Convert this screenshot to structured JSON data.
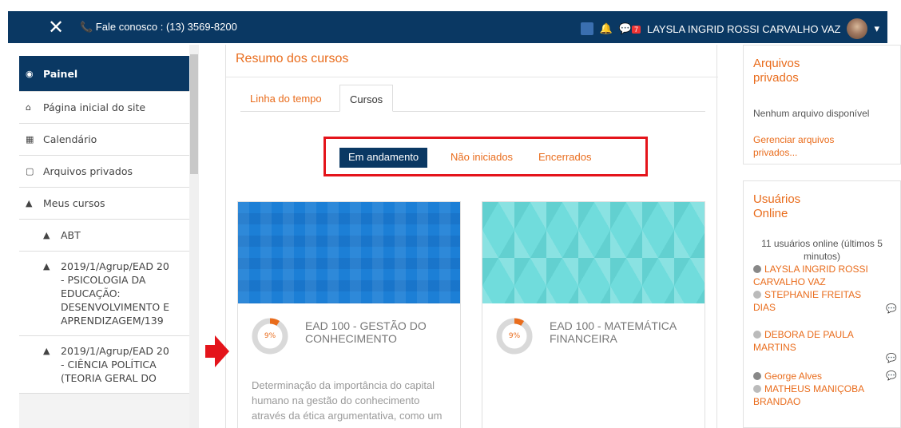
{
  "navbar": {
    "close_glyph": "✕",
    "phone": "📞 Fale conosco : (13) 3569-8200",
    "messages_count": "7",
    "user_name": "LAYSLA INGRID ROSSI CARVALHO VAZ",
    "caret": "▾",
    "icons": [
      "close-icon",
      "phone-icon",
      "translate-icon",
      "bell-icon",
      "chat-icon",
      "avatar",
      "caret-down-icon"
    ]
  },
  "sidebar": {
    "items": [
      {
        "icon": "dashboard-icon",
        "glyph": "◉",
        "label": "Painel"
      },
      {
        "icon": "home-icon",
        "glyph": "⌂",
        "label": "Página inicial do site"
      },
      {
        "icon": "calendar-icon",
        "glyph": "▦",
        "label": "Calendário"
      },
      {
        "icon": "file-icon",
        "glyph": "▢",
        "label": "Arquivos privados"
      },
      {
        "icon": "graduation-cap-icon",
        "glyph": "▲",
        "label": "Meus cursos"
      },
      {
        "icon": "graduation-cap-icon",
        "glyph": "▲",
        "label": "ABT"
      },
      {
        "icon": "graduation-cap-icon",
        "glyph": "▲",
        "label": "2019/1/Agrup/EAD 20 - PSICOLOGIA DA EDUCAÇÃO: DESENVOLVIMENTO E APRENDIZAGEM/139"
      },
      {
        "icon": "graduation-cap-icon",
        "glyph": "▲",
        "label": "2019/1/Agrup/EAD 20 - CIÊNCIA POLÍTICA (TEORIA GERAL DO"
      }
    ]
  },
  "main": {
    "title": "Resumo dos cursos",
    "tabs": [
      {
        "label": "Linha do tempo",
        "active": false
      },
      {
        "label": "Cursos",
        "active": true
      }
    ],
    "filters": [
      {
        "label": "Em andamento",
        "active": true
      },
      {
        "label": "Não iniciados",
        "active": false
      },
      {
        "label": "Encerrados",
        "active": false
      }
    ],
    "courses": [
      {
        "name": "EAD 100 - GESTÃO DO CONHECIMENTO",
        "progress_percent": 9,
        "progress_label": "9%",
        "description": "Determinação da importância do capital humano na gestão do conhecimento através da ética argumentativa, como um novo"
      },
      {
        "name": "EAD 100 - MATEMÁTICA FINANCEIRA",
        "progress_percent": 9,
        "progress_label": "9%",
        "description": ""
      }
    ]
  },
  "right": {
    "files": {
      "title": "Arquivos privados",
      "empty_text": "Nenhum arquivo disponível",
      "manage_link": "Gerenciar arquivos privados..."
    },
    "online": {
      "title": "Usuários Online",
      "summary": "11 usuários online (últimos 5 minutos)",
      "users": [
        {
          "name": "LAYSLA INGRID ROSSI CARVALHO VAZ",
          "has_photo": true,
          "message": false
        },
        {
          "name": "STEPHANIE FREITAS DIAS",
          "has_photo": false,
          "message": true
        },
        {
          "name": "DEBORA DE PAULA MARTINS",
          "has_photo": false,
          "message": true
        },
        {
          "name": "George Alves",
          "has_photo": true,
          "message": true
        },
        {
          "name": "MATHEUS MANIÇOBA BRANDAO",
          "has_photo": false,
          "message": false
        }
      ]
    }
  },
  "colors": {
    "navy": "#0a3863",
    "accent_orange": "#e96c1c",
    "highlight_red": "#e4141b",
    "progress_track": "#d9d9d9"
  }
}
